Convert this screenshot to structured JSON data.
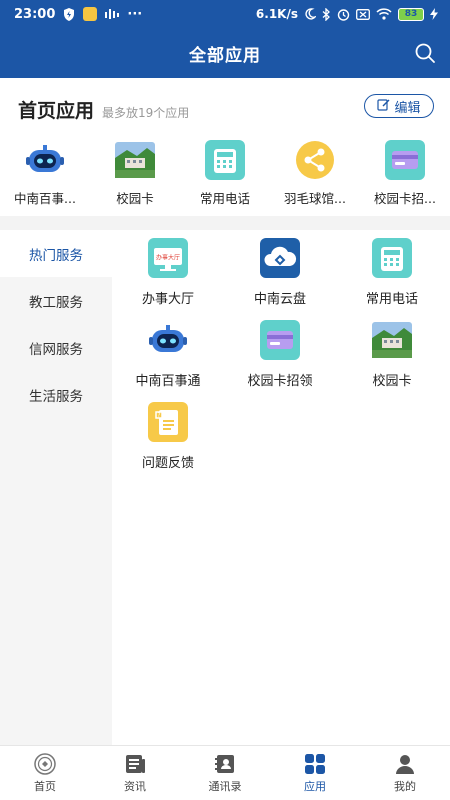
{
  "status_bar": {
    "time": "23:00",
    "dots": "···",
    "network_speed": "6.1K/s",
    "battery": "83"
  },
  "header": {
    "title": "全部应用",
    "search_icon": "search-icon"
  },
  "home_apps": {
    "title": "首页应用",
    "subtitle": "最多放19个应用",
    "edit_label": "编辑",
    "items": [
      {
        "label": "中南百事...",
        "icon": "robot-icon"
      },
      {
        "label": "校园卡",
        "icon": "campus-photo-icon"
      },
      {
        "label": "常用电话",
        "icon": "telephone-icon"
      },
      {
        "label": "羽毛球馆...",
        "icon": "share-icon"
      },
      {
        "label": "校园卡招...",
        "icon": "card-icon"
      }
    ]
  },
  "categories": [
    {
      "label": "热门服务",
      "active": true
    },
    {
      "label": "教工服务",
      "active": false
    },
    {
      "label": "信网服务",
      "active": false
    },
    {
      "label": "生活服务",
      "active": false
    }
  ],
  "apps": [
    {
      "label": "办事大厅",
      "icon": "service-hall-icon",
      "badge": "办事大厅"
    },
    {
      "label": "中南云盘",
      "icon": "cloud-disk-icon"
    },
    {
      "label": "常用电话",
      "icon": "telephone-icon"
    },
    {
      "label": "中南百事通",
      "icon": "robot-icon"
    },
    {
      "label": "校园卡招领",
      "icon": "card-icon"
    },
    {
      "label": "校园卡",
      "icon": "campus-photo-icon"
    },
    {
      "label": "问题反馈",
      "icon": "feedback-icon"
    }
  ],
  "bottom_nav": [
    {
      "label": "首页",
      "icon": "home-logo-icon",
      "active": false
    },
    {
      "label": "资讯",
      "icon": "news-icon",
      "active": false
    },
    {
      "label": "通讯录",
      "icon": "contacts-icon",
      "active": false
    },
    {
      "label": "应用",
      "icon": "apps-grid-icon",
      "active": true
    },
    {
      "label": "我的",
      "icon": "profile-icon",
      "active": false
    }
  ],
  "colors": {
    "primary": "#1c56a6",
    "teal_icon": "#5fd0cb",
    "yellow_icon": "#f7c948"
  }
}
